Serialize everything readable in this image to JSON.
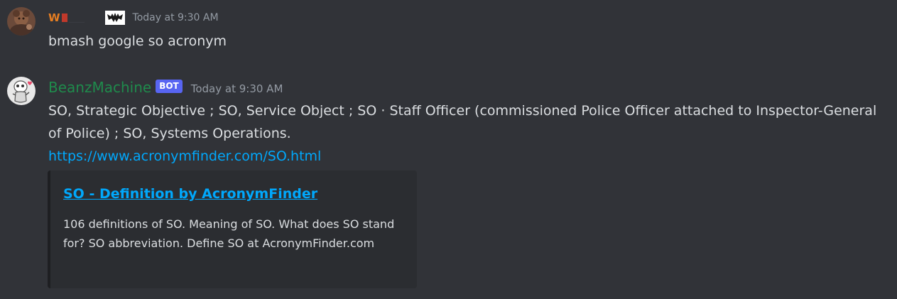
{
  "messages": [
    {
      "username_visible": "W",
      "timestamp": "Today at 9:30 AM",
      "content": "bmash google so acronym",
      "username_color": "#e67e22",
      "badge_icon": "bat-emblem-icon"
    },
    {
      "username": "BeanzMachine",
      "bot_tag": "BOT",
      "timestamp": "Today at 9:30 AM",
      "content": "SO, Strategic Objective ; SO, Service Object ; SO · Staff Officer (commissioned Police Officer attached to Inspector-General of Police) ; SO, Systems Operations.",
      "link": "https://www.acronymfinder.com/SO.html",
      "username_color": "#1f8b4c",
      "embed": {
        "title": "SO - Definition by AcronymFinder",
        "description": "106 definitions of SO. Meaning of SO. What does SO stand for? SO abbreviation. Define SO at AcronymFinder.com"
      }
    }
  ],
  "colors": {
    "background": "#313338",
    "embed_background": "#2b2d31",
    "link": "#00a8fc",
    "bot_tag": "#5865f2",
    "timestamp": "#949ba4"
  }
}
